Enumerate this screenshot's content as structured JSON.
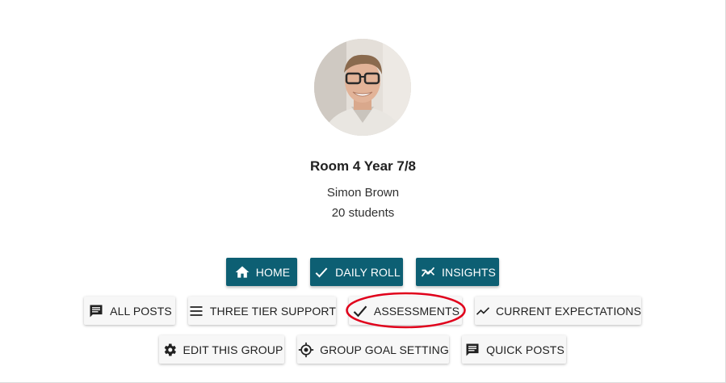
{
  "group": {
    "name": "Room 4 Year 7/8",
    "teacher": "Simon Brown",
    "students": "20 students"
  },
  "nav_primary": [
    {
      "label": "HOME",
      "icon": "home-icon"
    },
    {
      "label": "DAILY ROLL",
      "icon": "check-icon"
    },
    {
      "label": "INSIGHTS",
      "icon": "insights-icon"
    }
  ],
  "nav_secondary": [
    {
      "label": "ALL POSTS",
      "icon": "comment-icon"
    },
    {
      "label": "THREE TIER SUPPORT",
      "icon": "menu-icon"
    },
    {
      "label": "ASSESSMENTS",
      "icon": "check-icon"
    },
    {
      "label": "CURRENT EXPECTATIONS",
      "icon": "trending-icon"
    }
  ],
  "nav_tertiary": [
    {
      "label": "EDIT THIS GROUP",
      "icon": "gear-icon"
    },
    {
      "label": "GROUP GOAL SETTING",
      "icon": "target-icon"
    },
    {
      "label": "QUICK POSTS",
      "icon": "comment-icon"
    }
  ],
  "colors": {
    "primary": "#0d5f73",
    "secondary_bg": "#f7f7f7",
    "highlight": "#e0001b"
  }
}
